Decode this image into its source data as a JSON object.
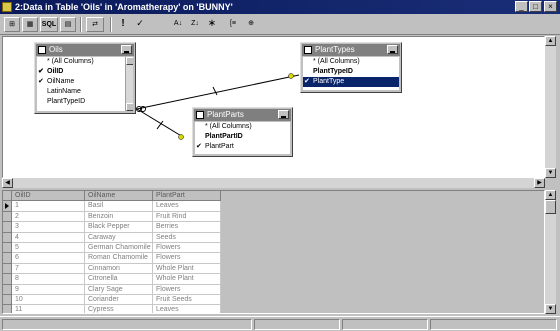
{
  "window": {
    "title": "2:Data in Table 'Oils' in 'Aromatherapy' on 'BUNNY'",
    "minimize_glyph": "_",
    "maximize_glyph": "□",
    "close_glyph": "×"
  },
  "toolbar": {
    "buttons": [
      {
        "name": "diagram-pane-icon",
        "glyph": "⊞"
      },
      {
        "name": "grid-pane-icon",
        "glyph": "▦"
      },
      {
        "name": "sql-pane-button",
        "label": "SQL"
      },
      {
        "name": "results-pane-icon",
        "glyph": "▤"
      },
      {
        "name": "query-type-icon",
        "glyph": "⇄"
      },
      {
        "name": "run-icon",
        "glyph": "!"
      },
      {
        "name": "verify-sql-icon",
        "glyph": "✓"
      },
      {
        "name": "sort-ascending-icon",
        "glyph": "A↓"
      },
      {
        "name": "sort-descending-icon",
        "glyph": "Z↓"
      },
      {
        "name": "remove-filter-icon",
        "glyph": "∗"
      },
      {
        "name": "group-by-icon",
        "glyph": "[≡"
      },
      {
        "name": "add-table-icon",
        "glyph": "⊕"
      }
    ]
  },
  "diagram": {
    "tables": {
      "oils": {
        "title": "Oils",
        "columns": [
          {
            "label": "* (All Columns)",
            "checked": false,
            "bold": false
          },
          {
            "label": "OilID",
            "checked": true,
            "bold": true
          },
          {
            "label": "OilName",
            "checked": true,
            "bold": false
          },
          {
            "label": "LatinName",
            "checked": false,
            "bold": false
          },
          {
            "label": "PlantTypeID",
            "checked": false,
            "bold": false
          }
        ]
      },
      "planttypes": {
        "title": "PlantTypes",
        "columns": [
          {
            "label": "* (All Columns)",
            "checked": false,
            "bold": false
          },
          {
            "label": "PlantTypeID",
            "checked": false,
            "bold": true
          },
          {
            "label": "PlantType",
            "checked": true,
            "bold": false,
            "selected": true
          }
        ]
      },
      "plantparts": {
        "title": "PlantParts",
        "columns": [
          {
            "label": "* (All Columns)",
            "checked": false,
            "bold": false
          },
          {
            "label": "PlantPartID",
            "checked": false,
            "bold": true
          },
          {
            "label": "PlantPart",
            "checked": true,
            "bold": false
          }
        ]
      }
    }
  },
  "grid": {
    "headers": [
      "OilID",
      "OilName",
      "PlantPart"
    ],
    "rows": [
      [
        "1",
        "Basil",
        "Leaves"
      ],
      [
        "2",
        "Benzoin",
        "Fruit Rind"
      ],
      [
        "3",
        "Black Pepper",
        "Berries"
      ],
      [
        "4",
        "Caraway",
        "Seeds"
      ],
      [
        "5",
        "German Chamomile",
        "Flowers"
      ],
      [
        "6",
        "Roman Chamomile",
        "Flowers"
      ],
      [
        "7",
        "Cinnamon",
        "Whole Plant"
      ],
      [
        "8",
        "Citronella",
        "Whole Plant"
      ],
      [
        "9",
        "Clary Sage",
        "Flowers"
      ],
      [
        "10",
        "Coriander",
        "Fruit Seeds"
      ],
      [
        "11",
        "Cypress",
        "Leaves"
      ]
    ]
  },
  "colors": {
    "titlebar": "#0a1a5a",
    "selection": "#0a246a",
    "link_endpoint": "#d8d800"
  }
}
